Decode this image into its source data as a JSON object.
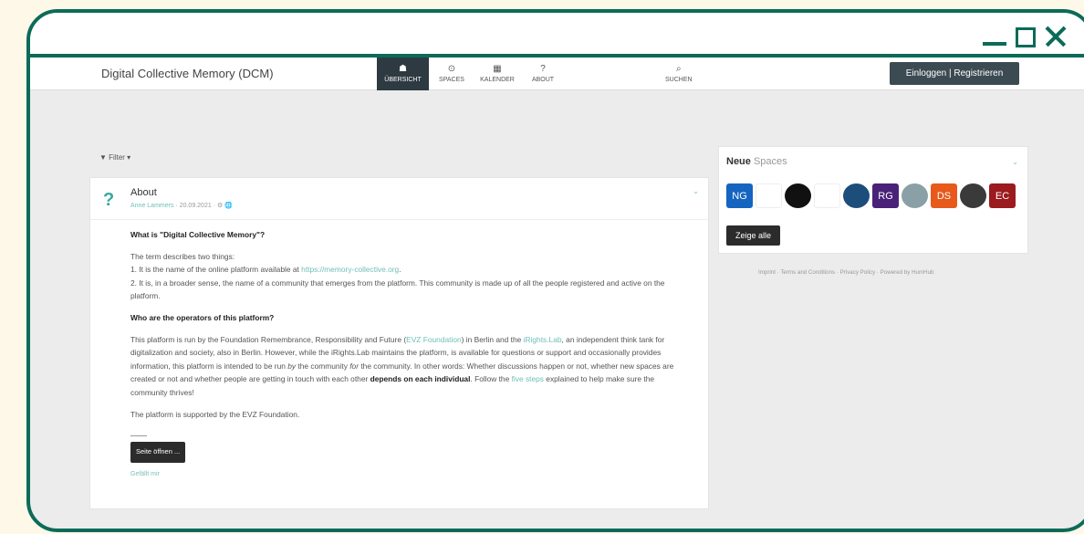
{
  "window": {
    "minimize_icon": "minimize-icon",
    "maximize_icon": "maximize-icon",
    "close_icon": "close-icon",
    "accent": "#0b6b59"
  },
  "header": {
    "brand": "Digital Collective Memory (DCM)",
    "nav": [
      {
        "label": "ÜBERSICHT",
        "icon": "home-icon",
        "glyph": "☗",
        "active": true
      },
      {
        "label": "SPACES",
        "icon": "target-icon",
        "glyph": "⊙"
      },
      {
        "label": "KALENDER",
        "icon": "calendar-icon",
        "glyph": "▦"
      },
      {
        "label": "ABOUT",
        "icon": "question-icon",
        "glyph": "?"
      }
    ],
    "search": {
      "label": "SUCHEN",
      "icon": "search-icon",
      "glyph": "⌕"
    },
    "login_label": "Einloggen | Registrieren"
  },
  "filter": {
    "label": "Filter",
    "glyph": "▼"
  },
  "post": {
    "icon_glyph": "?",
    "title": "About",
    "author": "Anne Lammers",
    "date": "20.09.2021",
    "meta_sep": " · ",
    "visibility_icons": "⚙ 🌐",
    "q1": "What is \"Digital Collective Memory\"?",
    "p1a": "The term describes two things:",
    "p1b": "1. It is the name of the online platform available at ",
    "p1b_link": "https://memory-collective.org",
    "p1b_end": ".",
    "p1c": "2. It is, in a broader sense, the name of a community that emerges from the platform. This community is made up of all the people registered and active on the platform.",
    "q2": "Who are the operators of this platform?",
    "p2_a": "This platform is run by the Foundation Remembrance, Responsibility and Future (",
    "p2_link1": "EVZ Foundation",
    "p2_b": ") in Berlin and the ",
    "p2_link2": "iRights.Lab",
    "p2_c": ", an independent think tank for digitalization and society, also in Berlin. However, while the iRights.Lab maintains the platform, is available for questions or support and occasionally provides information, this platform is intended to be run ",
    "p2_by": "by",
    "p2_d": " the community ",
    "p2_for": "for",
    "p2_e": " the community. In other words: Whether discussions happen or not, whether new spaces are created or not and whether people are getting in touch with each other ",
    "p2_bold": "depends on each individual",
    "p2_f": ". Follow the ",
    "p2_link3": "five steps",
    "p2_g": " explained to help make sure the community thrives!",
    "p3": "The platform is supported by the EVZ Foundation.",
    "open_label": "Seite öffnen ...",
    "like_label": "Gefällt mir"
  },
  "spaces": {
    "title_bold": "Neue",
    "title_light": " Spaces",
    "items": [
      {
        "label": "NG",
        "color": "#1565c0",
        "text_color": "#ffffff"
      },
      {
        "label": "",
        "color": "#ffffff",
        "text_color": "#ffffff",
        "name": "space-avatar-purple-ribbon"
      },
      {
        "label": "",
        "color": "#111111",
        "text_color": "#ffffff",
        "name": "space-avatar-black-circle"
      },
      {
        "label": "",
        "color": "#ffffff",
        "text_color": "#777777",
        "name": "space-avatar-text-logo"
      },
      {
        "label": "",
        "color": "#1d4d7a",
        "text_color": "#ffffff",
        "name": "space-avatar-blue-circle"
      },
      {
        "label": "RG",
        "color": "#4a2178",
        "text_color": "#ffffff"
      },
      {
        "label": "",
        "color": "#8aa0a6",
        "text_color": "#ffffff",
        "name": "space-avatar-photo"
      },
      {
        "label": "DS",
        "color": "#e8591c",
        "text_color": "#ffffff"
      },
      {
        "label": "",
        "color": "#3a3a3a",
        "text_color": "#ffffff",
        "name": "space-avatar-portrait"
      },
      {
        "label": "EC",
        "color": "#9b1b1e",
        "text_color": "#ffffff"
      }
    ],
    "show_all_label": "Zeige alle"
  },
  "footer": {
    "links": [
      "Imprint",
      "Terms and Conditions",
      "Privacy Policy",
      "Powered by HumHub"
    ],
    "sep": "  ·  "
  }
}
